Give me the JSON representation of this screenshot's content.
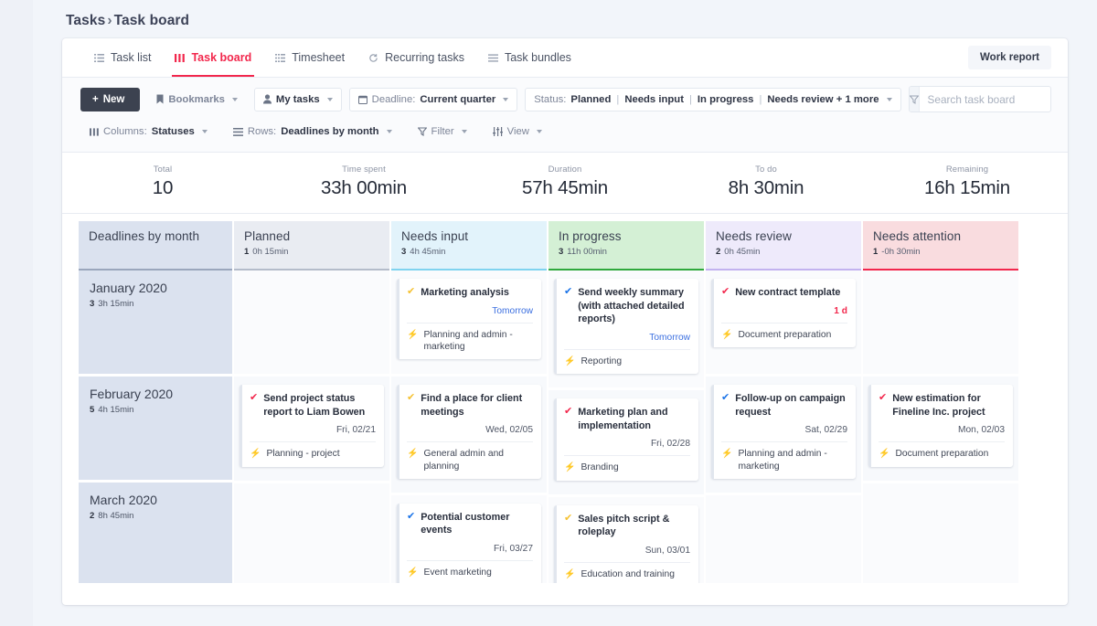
{
  "breadcrumb": {
    "root": "Tasks",
    "separator": "›",
    "current": "Task board"
  },
  "tabs": [
    {
      "label": "Task list",
      "icon": "list-icon",
      "active": false
    },
    {
      "label": "Task board",
      "icon": "board-icon",
      "active": true
    },
    {
      "label": "Timesheet",
      "icon": "grid-icon",
      "active": false
    },
    {
      "label": "Recurring tasks",
      "icon": "refresh-icon",
      "active": false
    },
    {
      "label": "Task bundles",
      "icon": "bundle-icon",
      "active": false
    }
  ],
  "work_report_label": "Work report",
  "toolbar": {
    "new_label": "New",
    "bookmarks_label": "Bookmarks",
    "my_tasks_label": "My tasks",
    "deadline_label": "Deadline:",
    "deadline_value": "Current quarter",
    "status_label": "Status:",
    "status_values": [
      "Planned",
      "Needs input",
      "In progress",
      "Needs review + 1 more"
    ],
    "columns_label": "Columns:",
    "columns_value": "Statuses",
    "rows_label": "Rows:",
    "rows_value": "Deadlines by month",
    "filter_label": "Filter",
    "view_label": "View",
    "search_placeholder": "Search task board",
    "search_value": ""
  },
  "stats": [
    {
      "label": "Total",
      "value": "10"
    },
    {
      "label": "Time spent",
      "value": "33h 00min"
    },
    {
      "label": "Duration",
      "value": "57h 45min"
    },
    {
      "label": "To do",
      "value": "8h 30min"
    },
    {
      "label": "Remaining",
      "value": "16h 15min"
    }
  ],
  "board": {
    "row_header_title": "Deadlines by month",
    "columns": [
      {
        "key": "planned",
        "title": "Planned",
        "count": "1",
        "time": "0h 15min",
        "accent": "#b4bcca"
      },
      {
        "key": "needsinput",
        "title": "Needs input",
        "count": "3",
        "time": "4h 45min",
        "accent": "#7fd3ef"
      },
      {
        "key": "inprogress",
        "title": "In progress",
        "count": "3",
        "time": "11h 00min",
        "accent": "#2fa83c"
      },
      {
        "key": "needsreview",
        "title": "Needs review",
        "count": "2",
        "time": "0h 45min",
        "accent": "#c2b2ef"
      },
      {
        "key": "needsattention",
        "title": "Needs attention",
        "count": "1",
        "time": "-0h 30min",
        "accent": "#f2274c"
      }
    ],
    "rows": [
      {
        "title": "January 2020",
        "count": "3",
        "time": "3h 15min",
        "cells": {
          "planned": [],
          "needsinput": [
            {
              "title": "Marketing analysis",
              "check_color": "#f5c131",
              "due": "Tomorrow",
              "due_style": "blue",
              "project": "Planning and admin - marketing"
            }
          ],
          "inprogress": [
            {
              "title": "Send weekly summary (with attached detailed reports)",
              "check_color": "#1a73e8",
              "due": "Tomorrow",
              "due_style": "blue",
              "project": "Reporting"
            }
          ],
          "needsreview": [
            {
              "title": "New contract template",
              "check_color": "#f2274c",
              "due": "1 d",
              "due_style": "red",
              "project": "Document preparation"
            }
          ],
          "needsattention": []
        }
      },
      {
        "title": "February 2020",
        "count": "5",
        "time": "4h 15min",
        "cells": {
          "planned": [
            {
              "title": "Send project status report to Liam Bowen",
              "check_color": "#f2274c",
              "due": "Fri, 02/21",
              "due_style": "grey",
              "project": "Planning - project"
            }
          ],
          "needsinput": [
            {
              "title": "Find a place for client meetings",
              "check_color": "#f5c131",
              "due": "Wed, 02/05",
              "due_style": "grey",
              "project": "General admin and planning"
            }
          ],
          "inprogress": [
            {
              "title": "Marketing plan and implementation",
              "check_color": "#f2274c",
              "due": "Fri, 02/28",
              "due_style": "grey",
              "project": "Branding"
            }
          ],
          "needsreview": [
            {
              "title": "Follow-up on campaign request",
              "check_color": "#1a73e8",
              "due": "Sat, 02/29",
              "due_style": "grey",
              "project": "Planning and admin - marketing"
            }
          ],
          "needsattention": [
            {
              "title": "New estimation for Fineline Inc. project",
              "check_color": "#f2274c",
              "due": "Mon, 02/03",
              "due_style": "grey",
              "project": "Document preparation"
            }
          ]
        }
      },
      {
        "title": "March 2020",
        "count": "2",
        "time": "8h 45min",
        "cells": {
          "planned": [],
          "needsinput": [
            {
              "title": "Potential customer events",
              "check_color": "#1a73e8",
              "due": "Fri, 03/27",
              "due_style": "grey",
              "project": "Event marketing"
            }
          ],
          "inprogress": [
            {
              "title": "Sales pitch script & roleplay",
              "check_color": "#f5c131",
              "due": "Sun, 03/01",
              "due_style": "grey",
              "project": "Education and training"
            }
          ],
          "needsreview": [],
          "needsattention": []
        }
      }
    ]
  }
}
